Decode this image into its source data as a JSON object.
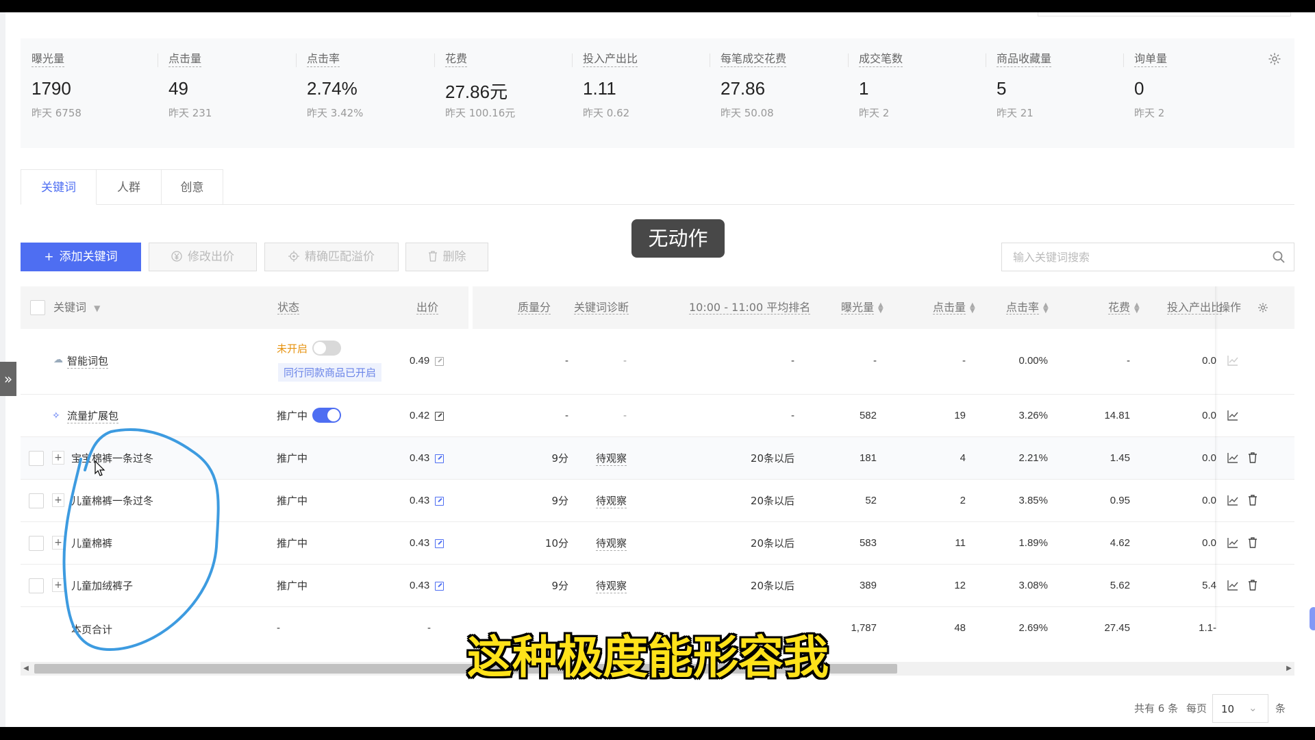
{
  "stats": [
    {
      "label": "曝光量",
      "value": "1790",
      "prev": "昨天 6758"
    },
    {
      "label": "点击量",
      "value": "49",
      "prev": "昨天 231"
    },
    {
      "label": "点击率",
      "value": "2.74%",
      "prev": "昨天 3.42%"
    },
    {
      "label": "花费",
      "value": "27.86元",
      "prev": "昨天 100.16元"
    },
    {
      "label": "投入产出比",
      "value": "1.11",
      "prev": "昨天 0.62"
    },
    {
      "label": "每笔成交花费",
      "value": "27.86",
      "prev": "昨天 50.08"
    },
    {
      "label": "成交笔数",
      "value": "1",
      "prev": "昨天 2"
    },
    {
      "label": "商品收藏量",
      "value": "5",
      "prev": "昨天 21"
    },
    {
      "label": "询单量",
      "value": "0",
      "prev": "昨天 2"
    }
  ],
  "tabs": [
    {
      "label": "关键词",
      "active": true
    },
    {
      "label": "人群",
      "active": false
    },
    {
      "label": "创意",
      "active": false
    }
  ],
  "toolbar": {
    "add_keyword": "添加关键词",
    "modify_bid": "修改出价",
    "exact_match_premium": "精确匹配溢价",
    "delete": "删除",
    "search_placeholder": "输入关键词搜索",
    "search_value": ""
  },
  "toast": "无动作",
  "table": {
    "headers": {
      "keyword": "关键词",
      "status": "状态",
      "bid": "出价",
      "quality": "质量分",
      "diagnosis": "关键词诊断",
      "avg_rank": "10:00 - 11:00 平均排名",
      "impressions": "曝光量",
      "clicks": "点击量",
      "ctr": "点击率",
      "cost": "花费",
      "roi": "投入产出比",
      "actions": "操作"
    },
    "rows": [
      {
        "keyword": "智能词包",
        "status": "未开启",
        "toggle": "off",
        "note": "同行同款商品已开启",
        "bid": "0.49",
        "quality": "-",
        "diagnosis": "-",
        "avg_rank": "-",
        "impressions": "-",
        "clicks": "-",
        "ctr": "0.00%",
        "cost": "-",
        "roi": "0.0"
      },
      {
        "keyword": "流量扩展包",
        "status": "推广中",
        "toggle": "on",
        "bid": "0.42",
        "quality": "-",
        "diagnosis": "-",
        "avg_rank": "-",
        "impressions": "582",
        "clicks": "19",
        "ctr": "3.26%",
        "cost": "14.81",
        "roi": "0.0"
      },
      {
        "keyword": "宝宝棉裤一条过冬",
        "status": "推广中",
        "bid": "0.43",
        "quality": "9分",
        "diagnosis": "待观察",
        "avg_rank": "20条以后",
        "impressions": "181",
        "clicks": "4",
        "ctr": "2.21%",
        "cost": "1.45",
        "roi": "0.0"
      },
      {
        "keyword": "儿童棉裤一条过冬",
        "status": "推广中",
        "bid": "0.43",
        "quality": "9分",
        "diagnosis": "待观察",
        "avg_rank": "20条以后",
        "impressions": "52",
        "clicks": "2",
        "ctr": "3.85%",
        "cost": "0.95",
        "roi": "0.0"
      },
      {
        "keyword": "儿童棉裤",
        "status": "推广中",
        "bid": "0.43",
        "quality": "10分",
        "diagnosis": "待观察",
        "avg_rank": "20条以后",
        "impressions": "583",
        "clicks": "11",
        "ctr": "1.89%",
        "cost": "4.62",
        "roi": "0.0"
      },
      {
        "keyword": "儿童加绒裤子",
        "status": "推广中",
        "bid": "0.43",
        "quality": "9分",
        "diagnosis": "待观察",
        "avg_rank": "20条以后",
        "impressions": "389",
        "clicks": "12",
        "ctr": "3.08%",
        "cost": "5.62",
        "roi": "5.4"
      }
    ],
    "total": {
      "label": "本页合计",
      "status": "-",
      "bid": "-",
      "impressions": "1,787",
      "clicks": "48",
      "ctr": "2.69%",
      "cost": "27.45",
      "roi": "1.1-"
    }
  },
  "pagination": {
    "total_text": "共有 6 条",
    "per_page_label": "每页",
    "per_page_value": "10",
    "unit": "条"
  },
  "subtitle": "这种极度能形容我",
  "colors": {
    "accent": "#4e6ef2",
    "warning": "#e6920f",
    "subtitle": "#ffe21a"
  }
}
